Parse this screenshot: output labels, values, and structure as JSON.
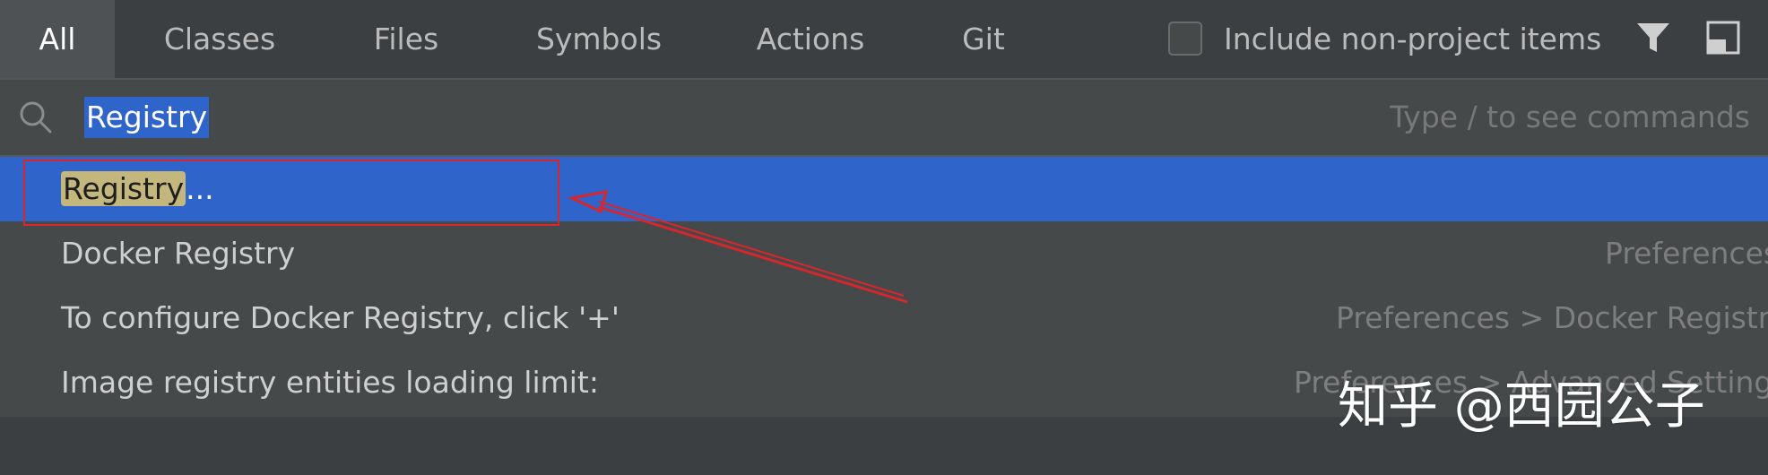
{
  "tabs": [
    {
      "label": "All",
      "active": true
    },
    {
      "label": "Classes"
    },
    {
      "label": "Files"
    },
    {
      "label": "Symbols"
    },
    {
      "label": "Actions"
    },
    {
      "label": "Git"
    }
  ],
  "include_non_project": {
    "label": "Include non-project items",
    "checked": false
  },
  "toolbar_icons": [
    "filter-icon",
    "preview-panel-icon"
  ],
  "search": {
    "value": "Registry",
    "placeholder_hint": "Type / to see commands"
  },
  "results": [
    {
      "highlight": "Registry",
      "rest": "...",
      "subtitle": "",
      "selected": true
    },
    {
      "text": "Docker Registry",
      "subtitle": "Preferences"
    },
    {
      "text": "To configure Docker Registry, click '+'",
      "subtitle": "Preferences > Docker Registry"
    },
    {
      "text": "Image registry entities loading limit:",
      "subtitle": "Preferences > Advanced Settings"
    }
  ],
  "watermark": "知乎 @西园公子",
  "colors": {
    "accent": "#2f65ca",
    "annotation": "#d8262d",
    "match_highlight": "#c4b77d"
  }
}
